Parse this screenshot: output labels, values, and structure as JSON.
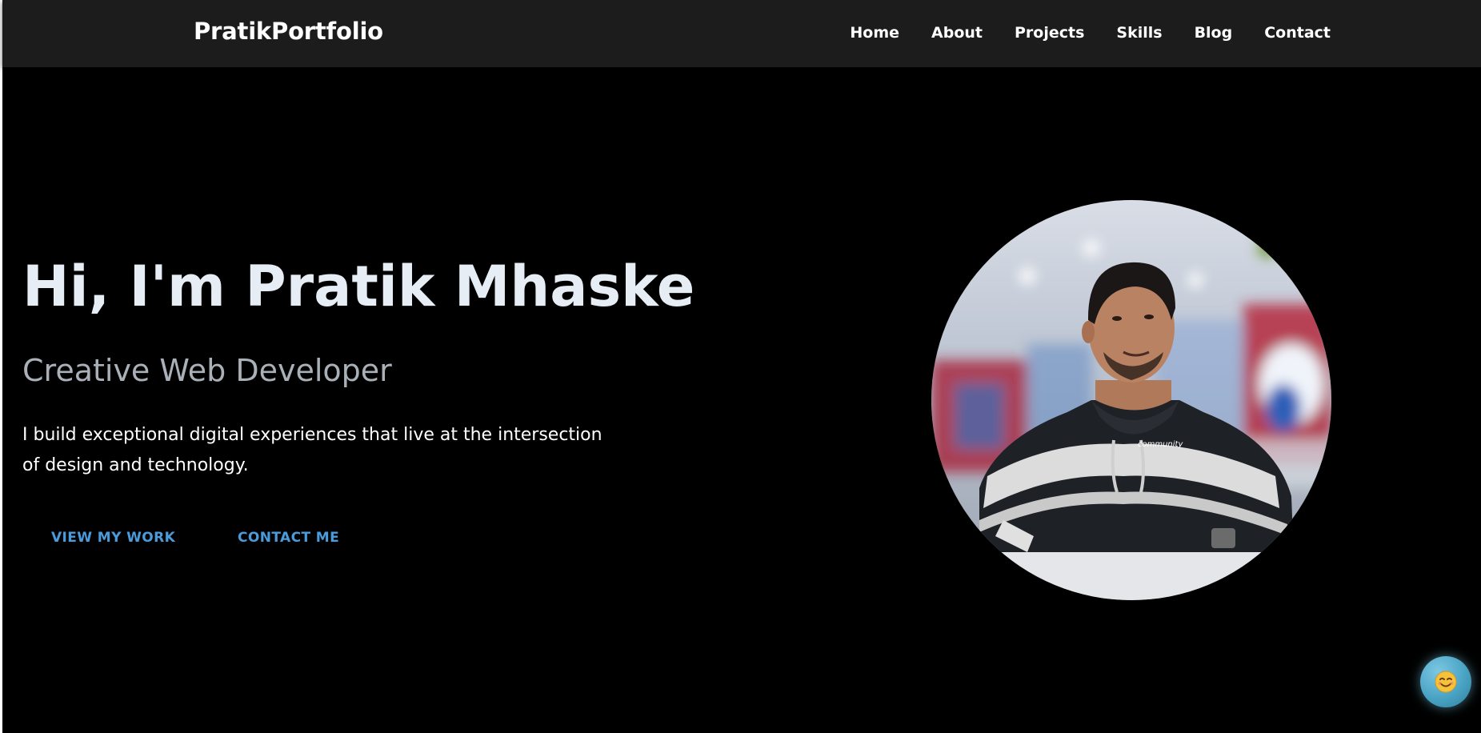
{
  "navbar": {
    "brand": "PratikPortfolio",
    "links": [
      "Home",
      "About",
      "Projects",
      "Skills",
      "Blog",
      "Contact"
    ]
  },
  "hero": {
    "title": "Hi, I'm Pratik Mhaske",
    "subtitle": "Creative Web Developer",
    "description": "I build exceptional digital experiences that live at the intersection of design and technology.",
    "primary_button": "VIEW MY WORK",
    "secondary_button": "CONTACT ME"
  },
  "profile_image": {
    "icon": "profile-photo"
  },
  "chat_widget": {
    "icon": "smiley-face-icon"
  },
  "colors": {
    "navbar_bg": "#1c1c1c",
    "page_bg": "#000000",
    "accent": "#4a9bdc",
    "title": "#e6edf5",
    "subtitle": "#a9b0b8"
  }
}
